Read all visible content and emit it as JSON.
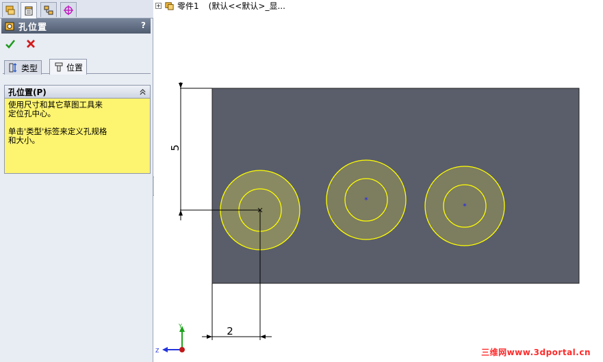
{
  "panel": {
    "tab_icons": [
      "feature-manager-icon",
      "property-manager-icon",
      "configuration-manager-icon",
      "dimxpert-icon"
    ],
    "title": "孔位置",
    "help": "?",
    "ok_icon": "check-icon",
    "cancel_icon": "x-icon",
    "tabs": [
      {
        "label": "类型",
        "icon": "hole-type-icon"
      },
      {
        "label": "位置",
        "icon": "hole-position-icon"
      }
    ],
    "group": {
      "title": "孔位置(P)",
      "line1": "使用尺寸和其它草图工具来\n定位孔中心。",
      "line2": "单击'类型'标签来定义孔规格\n和大小。"
    }
  },
  "tree": {
    "expand": "+",
    "label": "零件1",
    "config": "(默认<<默认>_显..."
  },
  "sketch": {
    "plate_color": "#5a5e6a",
    "hole_color": "#ffff00",
    "dim_vertical": "5",
    "dim_horizontal": "2"
  },
  "triad": {
    "x": "Z",
    "y": "Y"
  },
  "watermark": "三维网www.3dportal.cn"
}
